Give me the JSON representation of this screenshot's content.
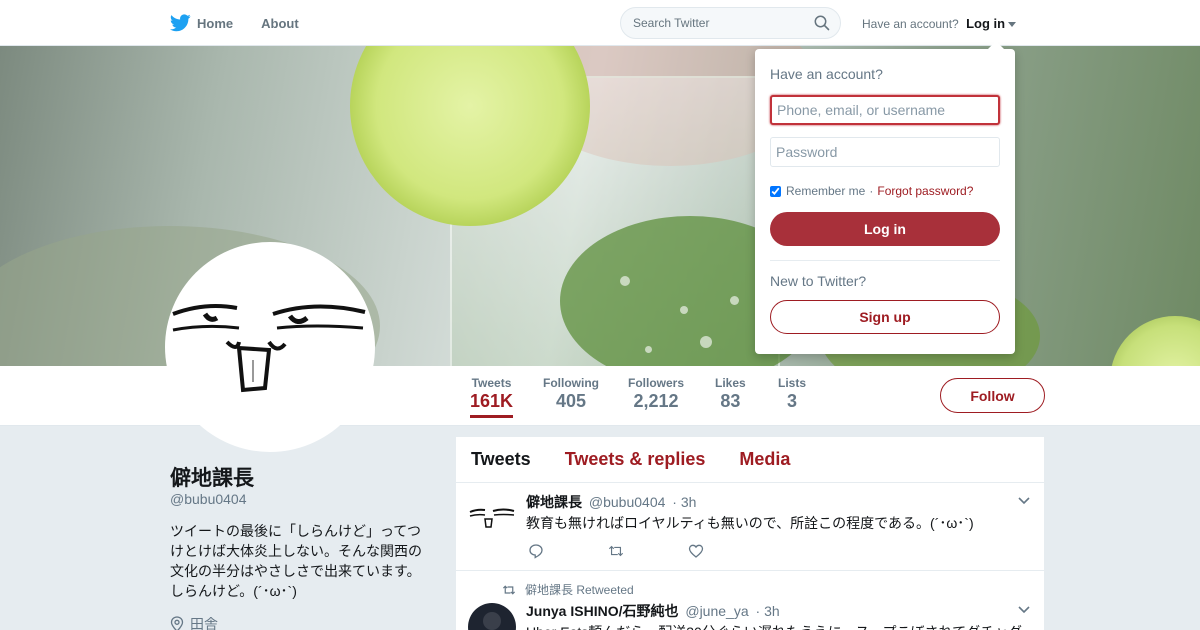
{
  "nav": {
    "home_label": "Home",
    "about_label": "About",
    "search_placeholder": "Search Twitter",
    "have_account_text": "Have an account?",
    "login_label": "Log in"
  },
  "profile": {
    "name": "僻地課長",
    "handle": "@bubu0404",
    "bio": "ツイートの最後に「しらんけど」ってつけとけば大体炎上しない。そんな関西の文化の半分はやさしさで出来ています。しらんけど。(´･ω･`)",
    "location": "田舎"
  },
  "stats": [
    {
      "label": "Tweets",
      "value": "161K"
    },
    {
      "label": "Following",
      "value": "405"
    },
    {
      "label": "Followers",
      "value": "2,212"
    },
    {
      "label": "Likes",
      "value": "83"
    },
    {
      "label": "Lists",
      "value": "3"
    }
  ],
  "follow_label": "Follow",
  "timeline": {
    "tabs": [
      "Tweets",
      "Tweets & replies",
      "Media"
    ],
    "tweets": [
      {
        "name": "僻地課長",
        "handle": "@bubu0404",
        "time": "· 3h",
        "text": "教育も無ければロイヤルティも無いので、所詮この程度である。(´･ω･`)"
      },
      {
        "retweet_context": "僻地課長 Retweeted",
        "name": "Junya ISHINO/石野純也",
        "handle": "@june_ya",
        "time": "· 3h",
        "text": "Uber Eats頼んだら、配送30分ぐらい遅れたうえに、スープこぼされてグチャグ"
      }
    ]
  },
  "login_dropdown": {
    "title": "Have an account?",
    "username_placeholder": "Phone, email, or username",
    "password_placeholder": "Password",
    "remember_label": "Remember me",
    "separator": "·",
    "forgot_label": "Forgot password?",
    "login_button": "Log in",
    "new_prompt": "New to Twitter?",
    "signup_button": "Sign up"
  },
  "colors": {
    "accent": "#9e1c22",
    "login_button_bg": "#a8303a",
    "twitter_blue": "#1da1f2",
    "muted": "#657786"
  },
  "icons": [
    "twitter-bird-icon",
    "search-icon",
    "caret-down-icon",
    "location-icon",
    "reply-icon",
    "retweet-icon",
    "like-icon",
    "chevron-down-icon"
  ]
}
